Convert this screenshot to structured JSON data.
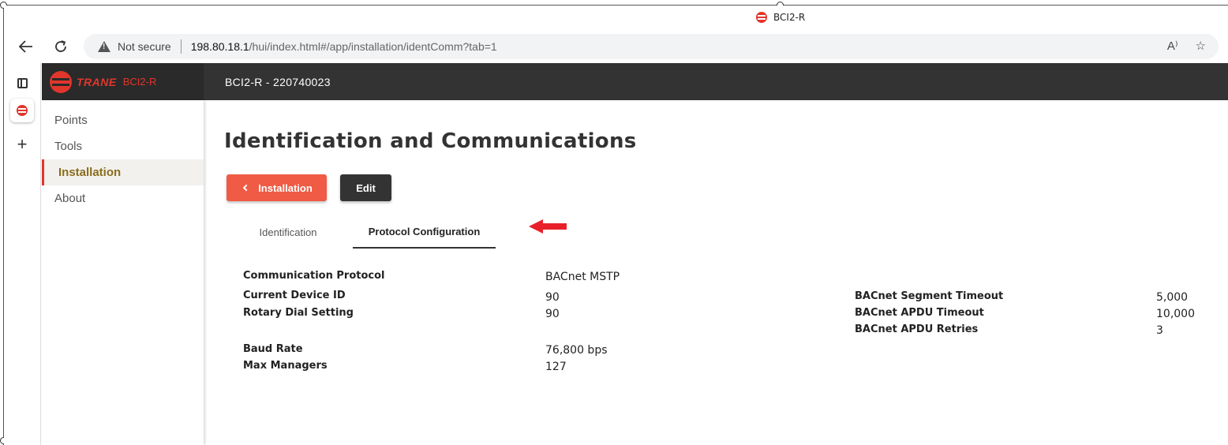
{
  "browser": {
    "tab_title": "BCI2-R",
    "security_label": "Not secure",
    "url_host": "198.80.18.1",
    "url_path": "/hui/index.html#/app/installation/identComm?tab=1",
    "read_aloud_glyph": "A⁾",
    "favorite_glyph": "☆"
  },
  "header": {
    "logo_word": "TRANE",
    "logo_model": "BCI2-R",
    "title": "BCI2-R - 220740023"
  },
  "sidebar": {
    "items": [
      {
        "label": "Points"
      },
      {
        "label": "Tools"
      },
      {
        "label": "Installation"
      },
      {
        "label": "About"
      }
    ]
  },
  "page": {
    "title": "Identification and Communications",
    "back_button": "Installation",
    "edit_button": "Edit",
    "tabs": [
      {
        "label": "Identification"
      },
      {
        "label": "Protocol Configuration"
      }
    ],
    "annotation_arrow_color": "#e8202a"
  },
  "fields_left": [
    {
      "label": "Communication Protocol",
      "value": "BACnet MSTP"
    },
    {
      "label": "Current Device ID",
      "value": "90"
    },
    {
      "label": "Rotary Dial Setting",
      "value": "90"
    },
    {
      "label": "Baud Rate",
      "value": "76,800 bps"
    },
    {
      "label": "Max Managers",
      "value": "127"
    }
  ],
  "fields_right": [
    {
      "label": "BACnet Segment Timeout",
      "value": "5,000"
    },
    {
      "label": "BACnet APDU Timeout",
      "value": "10,000"
    },
    {
      "label": "BACnet APDU Retries",
      "value": "3"
    }
  ],
  "colors": {
    "accent": "#e0362c",
    "back_button": "#ef5b44",
    "header": "#333333",
    "active_nav_text": "#8a6d1c"
  }
}
